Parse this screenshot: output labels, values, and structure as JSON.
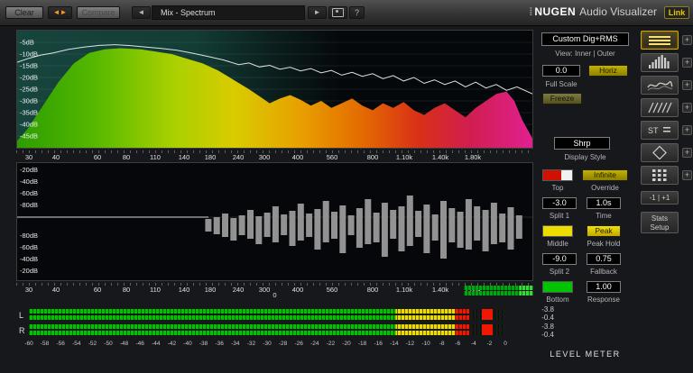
{
  "toolbar": {
    "clear": "Clear",
    "arrows": "◄►",
    "compare": "Compare",
    "prev_glyph": "◄",
    "preset": "Mix - Spectrum",
    "play_glyph": "►",
    "help": "?",
    "brand_dots": "⁞",
    "brand_nugen": "NUGEN",
    "brand_product": "Audio Visualizer",
    "link": "Link"
  },
  "spectrum": {
    "db_labels": [
      "-5dB",
      "-10dB",
      "-15dB",
      "-20dB",
      "-25dB",
      "-30dB",
      "-35dB",
      "-40dB",
      "-45dB"
    ],
    "freq_labels": [
      "30",
      "40",
      "60",
      "80",
      "110",
      "140",
      "180",
      "240",
      "300",
      "400",
      "560",
      "800",
      "1.10k",
      "1.40k",
      "1.80k"
    ],
    "freq_pos": [
      0.024,
      0.077,
      0.157,
      0.213,
      0.269,
      0.325,
      0.375,
      0.43,
      0.48,
      0.545,
      0.61,
      0.69,
      0.75,
      0.82,
      0.883
    ],
    "curve_db": [
      [
        0,
        -47
      ],
      [
        0.02,
        -42
      ],
      [
        0.05,
        -32
      ],
      [
        0.08,
        -22
      ],
      [
        0.11,
        -14
      ],
      [
        0.14,
        -9.5
      ],
      [
        0.17,
        -8
      ],
      [
        0.2,
        -7.5
      ],
      [
        0.24,
        -8
      ],
      [
        0.27,
        -9
      ],
      [
        0.3,
        -10
      ],
      [
        0.33,
        -12
      ],
      [
        0.36,
        -14
      ],
      [
        0.39,
        -17
      ],
      [
        0.42,
        -21
      ],
      [
        0.45,
        -25
      ],
      [
        0.47,
        -28
      ],
      [
        0.49,
        -31
      ],
      [
        0.51,
        -29
      ],
      [
        0.53,
        -27.5
      ],
      [
        0.55,
        -29.5
      ],
      [
        0.57,
        -32
      ],
      [
        0.59,
        -30
      ],
      [
        0.61,
        -33
      ],
      [
        0.63,
        -31
      ],
      [
        0.65,
        -29
      ],
      [
        0.67,
        -32
      ],
      [
        0.69,
        -34
      ],
      [
        0.71,
        -31
      ],
      [
        0.73,
        -33
      ],
      [
        0.75,
        -30.5
      ],
      [
        0.77,
        -34
      ],
      [
        0.79,
        -36
      ],
      [
        0.81,
        -33
      ],
      [
        0.83,
        -31
      ],
      [
        0.85,
        -34
      ],
      [
        0.87,
        -37
      ],
      [
        0.89,
        -33
      ],
      [
        0.91,
        -30
      ],
      [
        0.93,
        -27
      ],
      [
        0.95,
        -26
      ],
      [
        0.965,
        -30
      ],
      [
        0.98,
        -38
      ],
      [
        1,
        -46
      ]
    ],
    "peak_db": [
      [
        0,
        -13.5
      ],
      [
        0.02,
        -12
      ],
      [
        0.045,
        -10.5
      ],
      [
        0.07,
        -9.5
      ],
      [
        0.1,
        -8
      ],
      [
        0.13,
        -7
      ],
      [
        0.16,
        -6.3
      ],
      [
        0.19,
        -6
      ],
      [
        0.22,
        -6.4
      ],
      [
        0.25,
        -7
      ],
      [
        0.28,
        -7.6
      ],
      [
        0.31,
        -8.4
      ],
      [
        0.34,
        -9.6
      ],
      [
        0.37,
        -11
      ],
      [
        0.4,
        -12.5
      ],
      [
        0.43,
        -14.5
      ],
      [
        0.45,
        -13.8
      ],
      [
        0.47,
        -15.5
      ],
      [
        0.49,
        -14.8
      ],
      [
        0.51,
        -16.5
      ],
      [
        0.53,
        -15.6
      ],
      [
        0.55,
        -17.2
      ],
      [
        0.57,
        -16.2
      ],
      [
        0.59,
        -18
      ],
      [
        0.61,
        -17
      ],
      [
        0.63,
        -19
      ],
      [
        0.65,
        -17.8
      ],
      [
        0.67,
        -19.5
      ],
      [
        0.69,
        -18.4
      ],
      [
        0.71,
        -20.5
      ],
      [
        0.73,
        -19.2
      ],
      [
        0.75,
        -21.5
      ],
      [
        0.77,
        -20
      ],
      [
        0.79,
        -22.5
      ],
      [
        0.81,
        -21
      ],
      [
        0.83,
        -23
      ],
      [
        0.85,
        -21.5
      ],
      [
        0.87,
        -24
      ],
      [
        0.89,
        -22
      ],
      [
        0.91,
        -24.5
      ],
      [
        0.93,
        -23
      ],
      [
        0.95,
        -25.5
      ],
      [
        0.97,
        -24
      ],
      [
        1,
        -27
      ]
    ]
  },
  "diff_panel": {
    "db_labels": [
      "-20dB",
      "-40dB",
      "-60dB",
      "-80dB",
      "-80dB",
      "-60dB",
      "-40dB",
      "-20dB"
    ],
    "zero_label": "0",
    "bars": [
      [
        8,
        6
      ],
      [
        10,
        9
      ],
      [
        14,
        12
      ],
      [
        9,
        16
      ],
      [
        12,
        10
      ],
      [
        18,
        14
      ],
      [
        11,
        20
      ],
      [
        15,
        12
      ],
      [
        22,
        18
      ],
      [
        13,
        10
      ],
      [
        17,
        22
      ],
      [
        25,
        16
      ],
      [
        14,
        12
      ],
      [
        19,
        26
      ],
      [
        28,
        18
      ],
      [
        16,
        14
      ],
      [
        23,
        30
      ],
      [
        12,
        10
      ],
      [
        20,
        24
      ],
      [
        30,
        20
      ],
      [
        15,
        18
      ],
      [
        26,
        34
      ],
      [
        18,
        14
      ],
      [
        22,
        28
      ],
      [
        34,
        22
      ],
      [
        17,
        12
      ],
      [
        24,
        30
      ],
      [
        13,
        16
      ],
      [
        28,
        36
      ],
      [
        20,
        18
      ],
      [
        16,
        24
      ],
      [
        30,
        26
      ],
      [
        22,
        16
      ],
      [
        18,
        28
      ],
      [
        26,
        20
      ],
      [
        14,
        18
      ],
      [
        21,
        26
      ],
      [
        12,
        14
      ]
    ]
  },
  "level_meter": {
    "channels": [
      "L",
      "R"
    ],
    "scale": [
      "-60",
      "-58",
      "-56",
      "-54",
      "-52",
      "-50",
      "-48",
      "-46",
      "-44",
      "-42",
      "-40",
      "-38",
      "-36",
      "-34",
      "-32",
      "-30",
      "-28",
      "-26",
      "-24",
      "-22",
      "-20",
      "-18",
      "-16",
      "-14",
      "-12",
      "-10",
      "-8",
      "-6",
      "-4",
      "-2",
      "0"
    ],
    "readouts": [
      "-3.8",
      "-0.4",
      "-3.8",
      "-0.4"
    ],
    "title": "LEVEL METER"
  },
  "controls": {
    "mode": "Custom Dig+RMS",
    "view": "View: Inner | Outer",
    "full_scale_value": "0.0",
    "horiz": "Horiz",
    "full_scale_label": "Full Scale",
    "freeze": "Freeze",
    "display_style_value": "Shrp",
    "display_style_label": "Display Style",
    "infinite": "Infinite",
    "top_label": "Top",
    "override_label": "Override",
    "split1_value": "-3.0",
    "time_value": "1.0s",
    "split1_label": "Split 1",
    "time_label": "Time",
    "peak": "Peak",
    "middle_label": "Middle",
    "peak_hold_label": "Peak Hold",
    "split2_value": "-9.0",
    "fallback_value": "0.75",
    "split2_label": "Split 2",
    "fallback_label": "Fallback",
    "response_value": "1.00",
    "bottom_label": "Bottom",
    "response_label": "Response"
  },
  "side_panel": {
    "views": [
      {
        "icon": "level-meter",
        "selected": true
      },
      {
        "icon": "spectrum",
        "selected": false
      },
      {
        "icon": "spectrogram",
        "selected": false
      },
      {
        "icon": "history",
        "selected": false
      },
      {
        "icon": "stereo",
        "selected": false
      },
      {
        "icon": "vectorscope",
        "selected": false
      },
      {
        "icon": "grid",
        "selected": false
      }
    ],
    "st_label": "ST",
    "plus_label": "+",
    "channel_button": "-1 | +1",
    "stats_line1": "Stats",
    "stats_line2": "Setup"
  }
}
